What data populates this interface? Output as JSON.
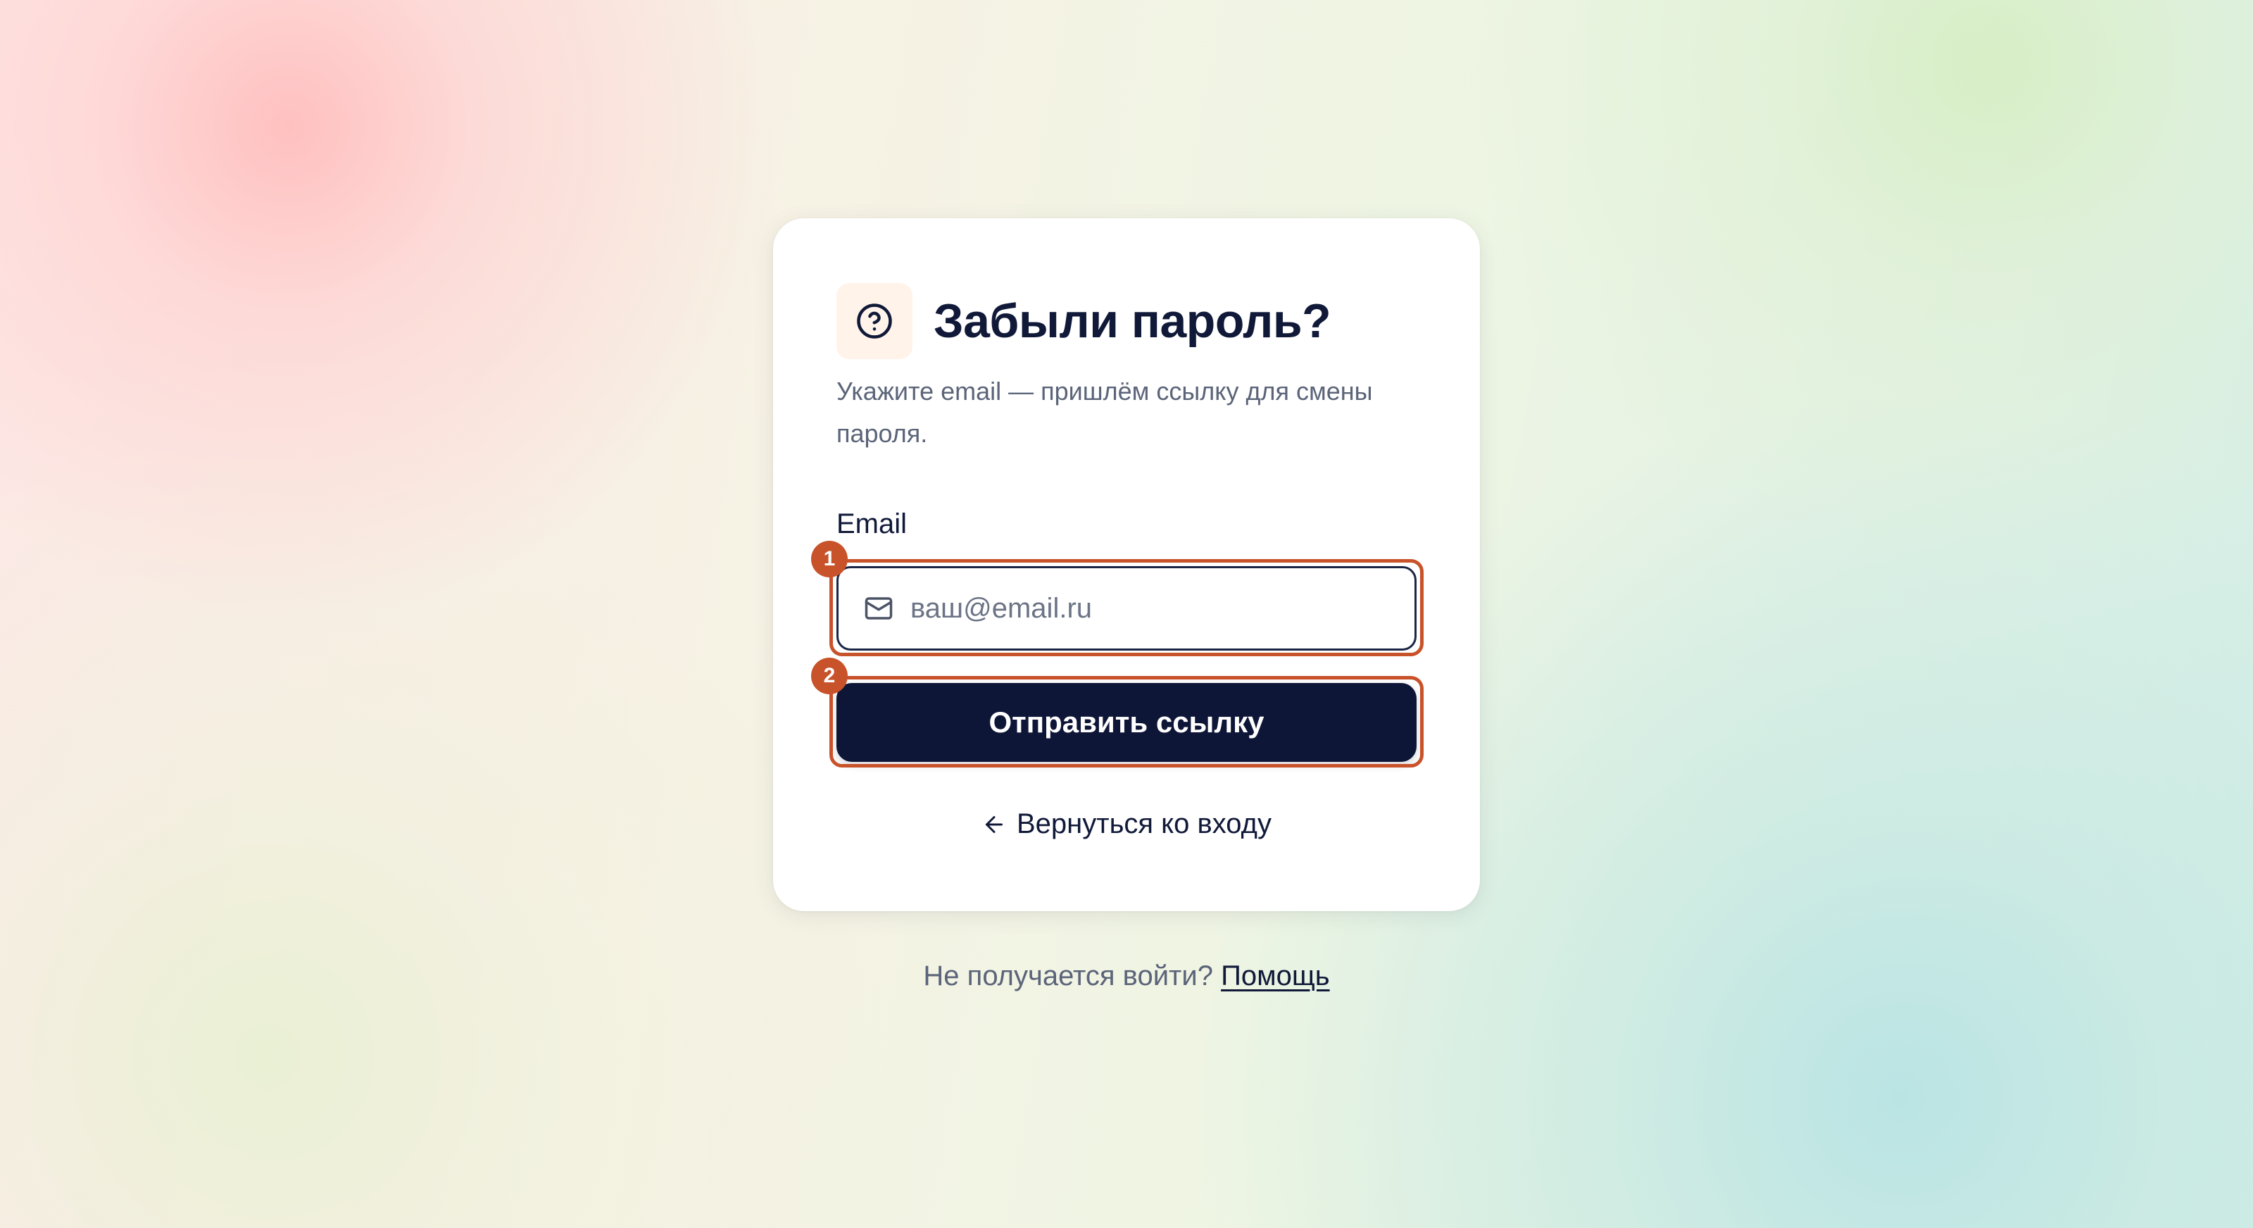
{
  "card": {
    "title": "Забыли пароль?",
    "title_icon": "question-circle-icon",
    "subtitle": "Укажите email — пришлём ссылку для смены пароля."
  },
  "email_field": {
    "label": "Email",
    "icon": "mail-icon",
    "value": "",
    "placeholder": "ваш@email.ru"
  },
  "submit_button": {
    "label": "Отправить ссылку"
  },
  "back_link": {
    "icon": "arrow-left-icon",
    "label": "Вернуться ко входу"
  },
  "footer": {
    "text": "Не получается войти?",
    "help_link": "Помощь"
  },
  "annotations": [
    {
      "number": "1",
      "target": "email-input"
    },
    {
      "number": "2",
      "target": "send-link-button"
    }
  ],
  "colors": {
    "primary": "#0e1638",
    "text": "#101938",
    "muted": "#5b6479",
    "annotation": "#c8522a",
    "icon_bg": "#fff3ea"
  }
}
